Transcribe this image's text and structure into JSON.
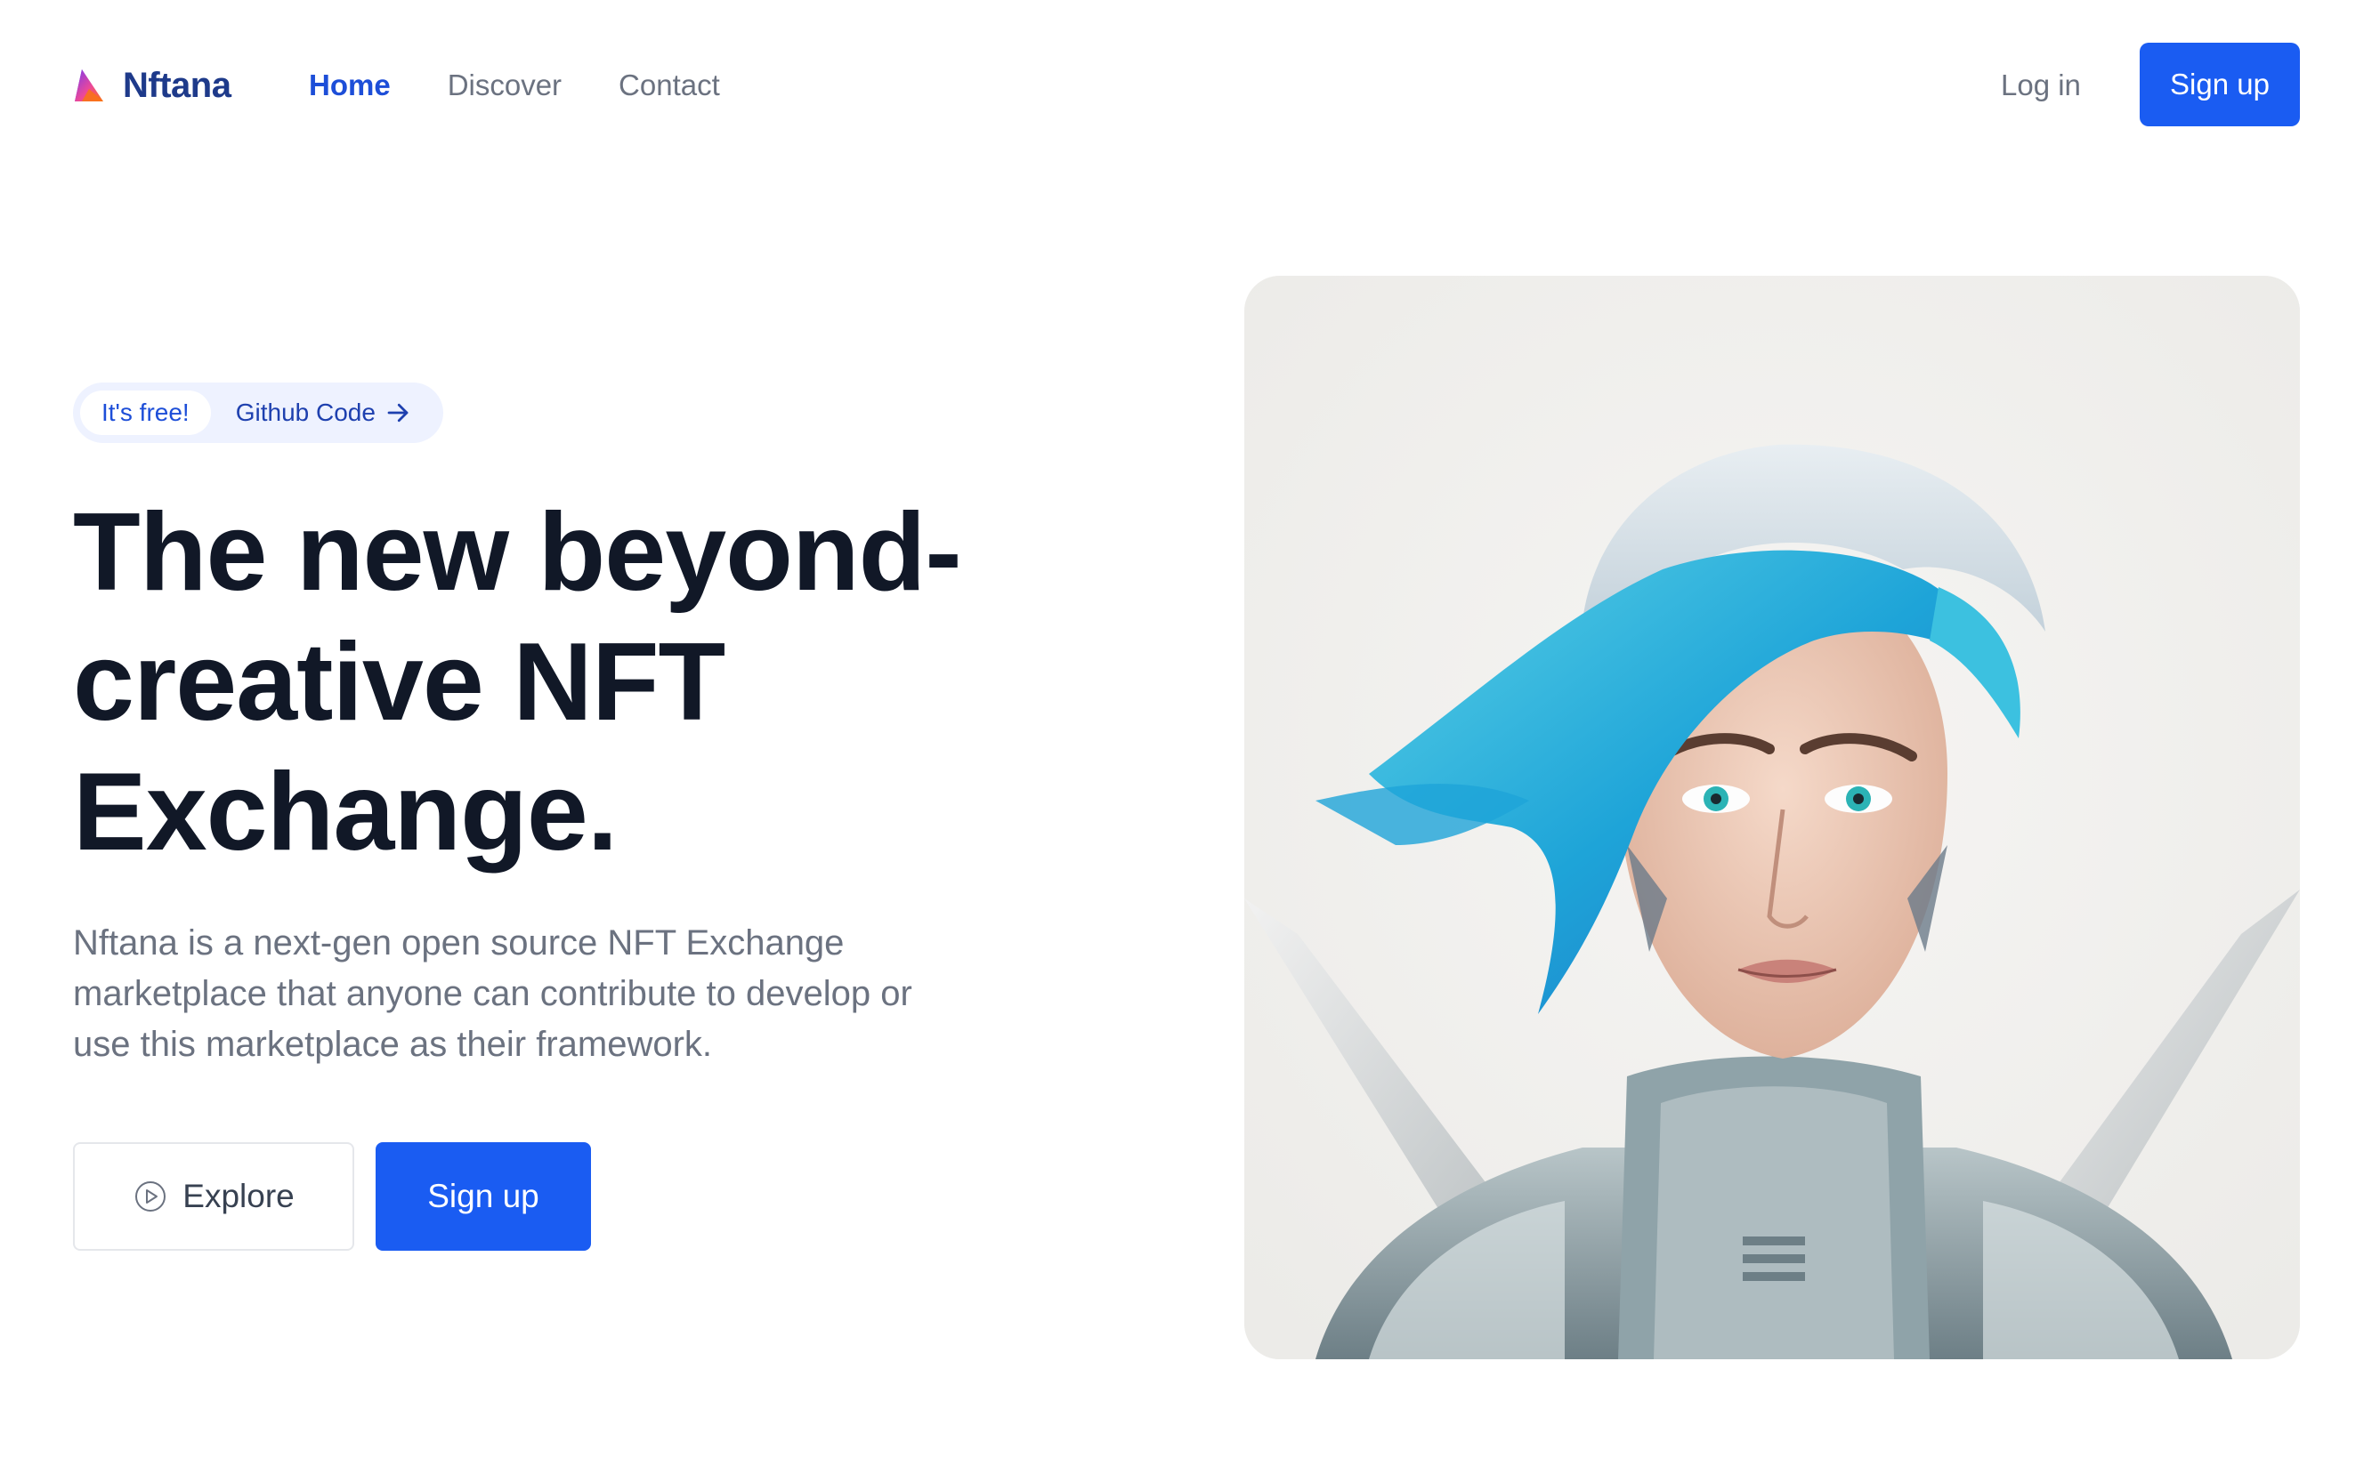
{
  "nav": {
    "brand": "Nftana",
    "links": [
      {
        "label": "Home",
        "active": true
      },
      {
        "label": "Discover",
        "active": false
      },
      {
        "label": "Contact",
        "active": false
      }
    ],
    "login_label": "Log in",
    "signup_label": "Sign up"
  },
  "hero": {
    "badge": {
      "pill_label": "It's free!",
      "link_label": "Github Code"
    },
    "headline_lines": [
      "The new beyond-",
      "creative NFT",
      "Exchange."
    ],
    "description_lines": [
      "Nftana is a next-gen open source NFT Exchange",
      "marketplace that anyone can contribute to develop or",
      "use this marketplace as their framework."
    ],
    "explore_label": "Explore",
    "signup_label": "Sign up"
  },
  "colors": {
    "primary": "#1a5cf2",
    "brand_text": "#1e3a8a",
    "active_link": "#1d4ed8",
    "muted_text": "#6b7280",
    "headline": "#111827",
    "badge_bg": "#eef2ff"
  },
  "icons": {
    "logo": "brand-logo-icon",
    "arrow": "arrow-right-icon",
    "play": "play-circle-icon"
  }
}
